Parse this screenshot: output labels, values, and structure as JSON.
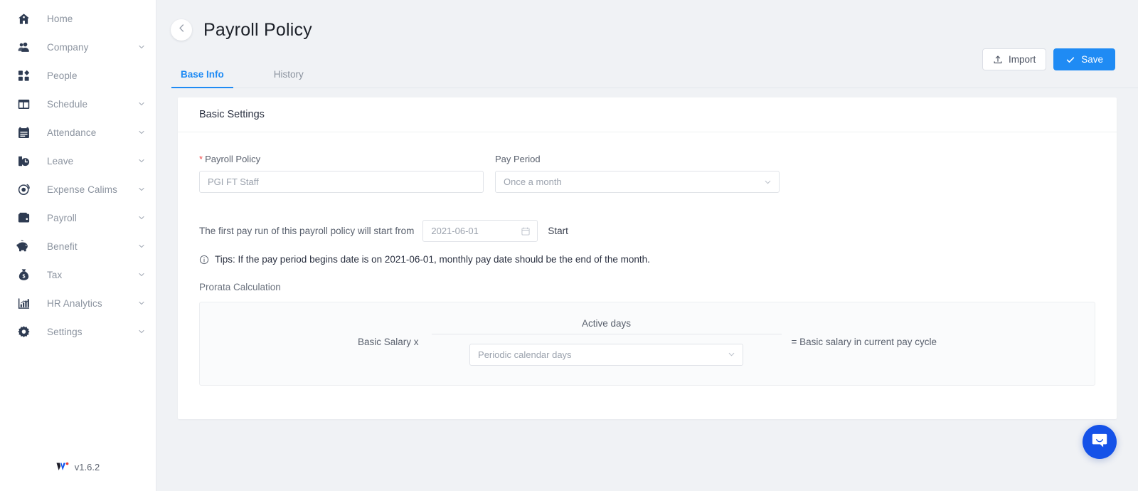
{
  "sidebar": {
    "items": [
      {
        "label": "Home",
        "icon": "home-icon",
        "expandable": false
      },
      {
        "label": "Company",
        "icon": "company-icon",
        "expandable": true
      },
      {
        "label": "People",
        "icon": "people-icon",
        "expandable": false
      },
      {
        "label": "Schedule",
        "icon": "schedule-icon",
        "expandable": true
      },
      {
        "label": "Attendance",
        "icon": "attendance-icon",
        "expandable": true
      },
      {
        "label": "Leave",
        "icon": "leave-icon",
        "expandable": true
      },
      {
        "label": "Expense Calims",
        "icon": "expense-icon",
        "expandable": true
      },
      {
        "label": "Payroll",
        "icon": "payroll-icon",
        "expandable": true
      },
      {
        "label": "Benefit",
        "icon": "benefit-icon",
        "expandable": true
      },
      {
        "label": "Tax",
        "icon": "tax-icon",
        "expandable": true
      },
      {
        "label": "HR Analytics",
        "icon": "analytics-icon",
        "expandable": true
      },
      {
        "label": "Settings",
        "icon": "settings-icon",
        "expandable": true
      }
    ],
    "version": "v1.6.2"
  },
  "header": {
    "title": "Payroll Policy",
    "back_icon": "chevron-left-icon"
  },
  "toolbar": {
    "import_label": "Import",
    "save_label": "Save"
  },
  "tabs": [
    {
      "label": "Base Info",
      "active": true
    },
    {
      "label": "History",
      "active": false
    }
  ],
  "card": {
    "title": "Basic Settings"
  },
  "form": {
    "payroll_policy": {
      "label": "Payroll Policy",
      "required_mark": "*",
      "value": "PGI FT Staff",
      "placeholder": "PGI FT Staff"
    },
    "pay_period": {
      "label": "Pay Period",
      "value": "Once a month",
      "options": [
        "Once a month"
      ]
    },
    "start": {
      "prefix_text": "The first pay run of this payroll policy will start from",
      "date_value": "2021-06-01",
      "button_label": "Start"
    },
    "tips": {
      "text": "Tips: If the pay period begins date is on 2021-06-01, monthly pay date should be the end of the month."
    },
    "prorata": {
      "label": "Prorata Calculation",
      "left_text": "Basic Salary x",
      "numerator": "Active days",
      "denominator_value": "Periodic calendar days",
      "denominator_options": [
        "Periodic calendar days"
      ],
      "right_text": "= Basic salary in current pay cycle"
    }
  },
  "chat": {
    "icon": "chat-bubble-icon"
  },
  "colors": {
    "accent": "#1f8bf4",
    "chat_blue": "#1552e8",
    "required_red": "#f04b4b",
    "page_bg": "#f0f2f5",
    "sidebar_icon": "#2e3b52"
  }
}
